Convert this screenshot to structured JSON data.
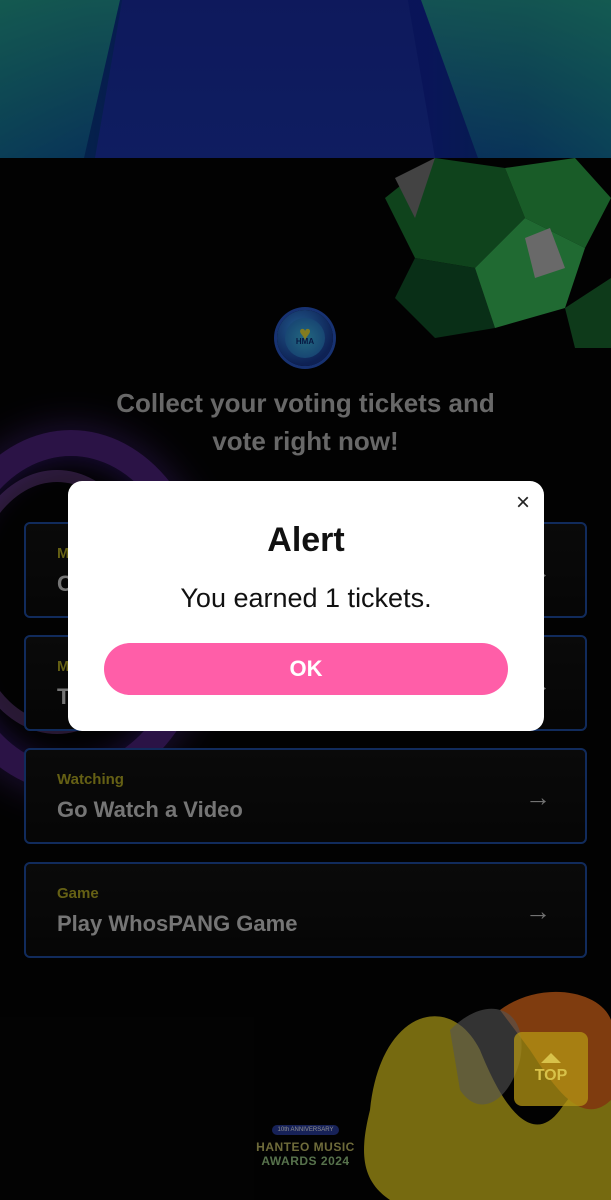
{
  "header": {
    "logo_text": "HMA",
    "headline_line1": "Collect your voting tickets and",
    "headline_line2": "vote right now!"
  },
  "missions": [
    {
      "category": "M",
      "title": "C"
    },
    {
      "category": "M",
      "title": "T"
    },
    {
      "category": "Watching",
      "title": "Go Watch a Video"
    },
    {
      "category": "Game",
      "title": "Play WhosPANG Game"
    }
  ],
  "icons": {
    "arrow": "→",
    "close": "×"
  },
  "modal": {
    "title": "Alert",
    "message": "You earned 1 tickets.",
    "ok_label": "OK"
  },
  "top_button": {
    "label": "TOP"
  },
  "footer": {
    "badge": "10th ANNIVERSARY",
    "line1": "HANTEO MUSIC",
    "line2": "AWARDS 2024"
  },
  "colors": {
    "accent_pink": "#ff5ea8",
    "card_border": "#1f4fa8",
    "category_yellow": "#b9b025"
  }
}
